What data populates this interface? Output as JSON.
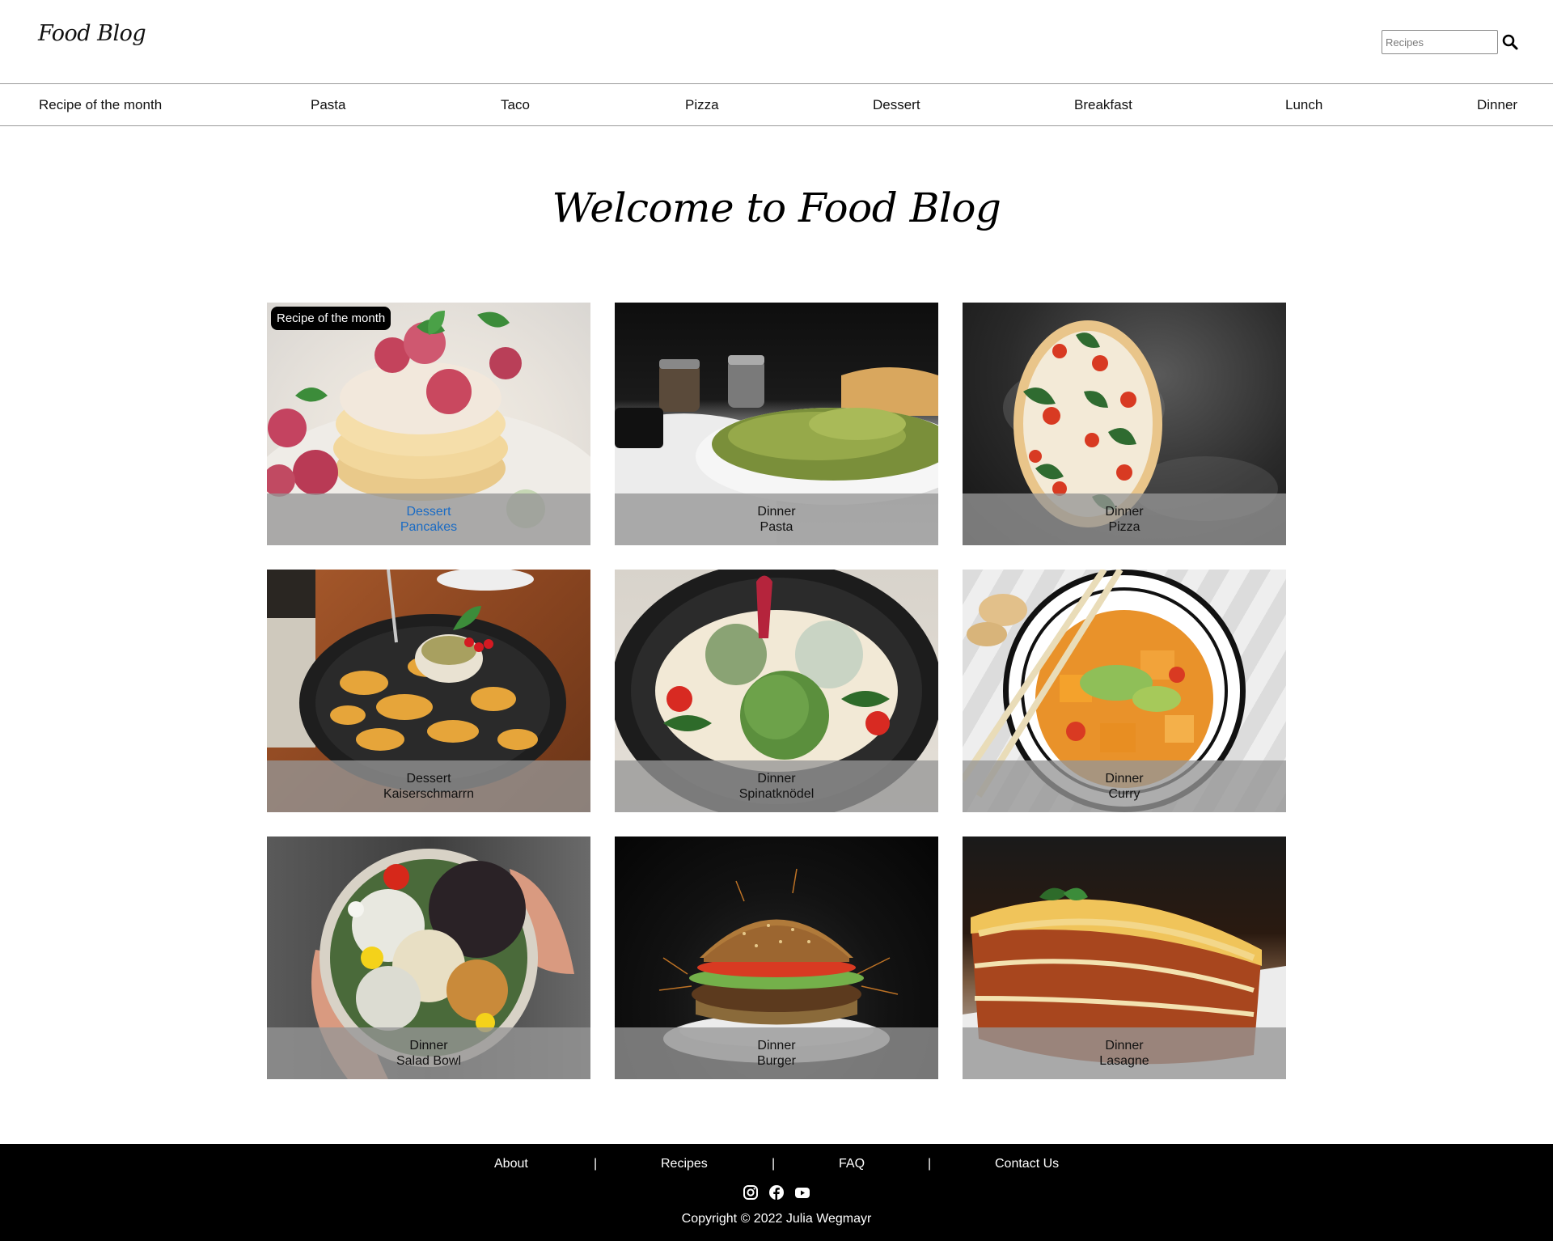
{
  "header": {
    "logo": "Food Blog",
    "search": {
      "placeholder": "Recipes",
      "value": ""
    }
  },
  "nav": {
    "items": [
      "Recipe of the month",
      "Pasta",
      "Taco",
      "Pizza",
      "Dessert",
      "Breakfast",
      "Lunch",
      "Dinner"
    ]
  },
  "main": {
    "title": "Welcome to Food Blog",
    "badge": "Recipe of the month",
    "cards": [
      {
        "category": "Dessert",
        "name": "Pancakes",
        "highlighted": true
      },
      {
        "category": "Dinner",
        "name": "Pasta"
      },
      {
        "category": "Dinner",
        "name": "Pizza"
      },
      {
        "category": "Dessert",
        "name": "Kaiserschmarrn"
      },
      {
        "category": "Dinner",
        "name": "Spinatknödel"
      },
      {
        "category": "Dinner",
        "name": "Curry"
      },
      {
        "category": "Dinner",
        "name": "Salad Bowl"
      },
      {
        "category": "Dinner",
        "name": "Burger"
      },
      {
        "category": "Dinner",
        "name": "Lasagne"
      }
    ]
  },
  "footer": {
    "links": [
      "About",
      "Recipes",
      "FAQ",
      "Contact Us"
    ],
    "separator": "|",
    "social_icons": [
      "instagram-icon",
      "facebook-icon",
      "youtube-icon"
    ],
    "copyright": "Copyright © 2022 Julia Wegmayr"
  },
  "colors": {
    "footer_bg": "#000000",
    "overlay": "#969696",
    "highlight_link": "#1a6bc4",
    "badge_bg": "#000000"
  }
}
